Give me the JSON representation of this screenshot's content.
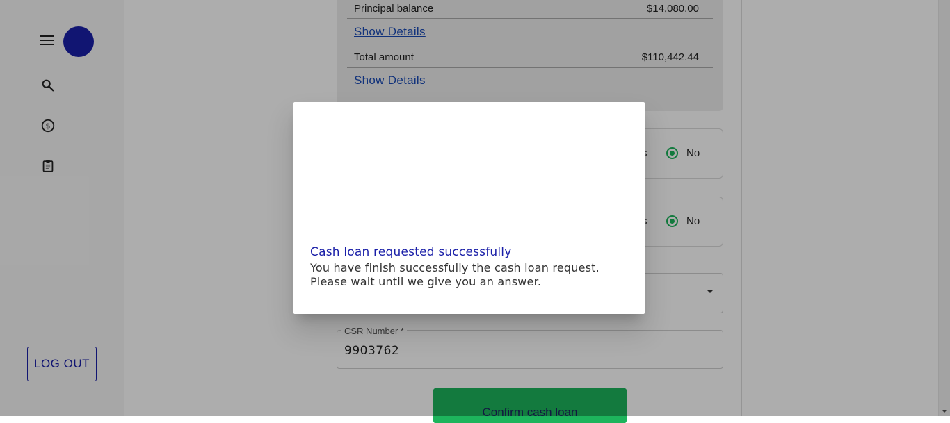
{
  "sidebar": {
    "logout_label": "LOG OUT",
    "avatar_color": "#1a1fa8",
    "icons": [
      "menu-icon",
      "search-icon",
      "dollar-circle-icon",
      "clipboard-icon"
    ]
  },
  "summary": {
    "principal_label": "Principal balance",
    "principal_value": "$14,080.00",
    "details_link_1": "Show Details",
    "total_label": "Total amount",
    "total_value": "$110,442.44",
    "details_link_2": "Show Details"
  },
  "questions": [
    {
      "partial_yes_label": "s",
      "selected_label": "No"
    },
    {
      "partial_yes_label": "s",
      "selected_label": "No"
    }
  ],
  "csr": {
    "label": "CSR Number *",
    "value": "9903762"
  },
  "confirm_label": "Confirm cash loan",
  "dialog": {
    "title": "Cash loan requested successfully",
    "message_line1": "You have finish successfully the cash loan request.",
    "message_line2": "Please wait until we give you an answer."
  },
  "colors": {
    "accent_blue": "#1a1fa8",
    "accent_green": "#1db45c",
    "link_blue": "#1a4bb5"
  }
}
